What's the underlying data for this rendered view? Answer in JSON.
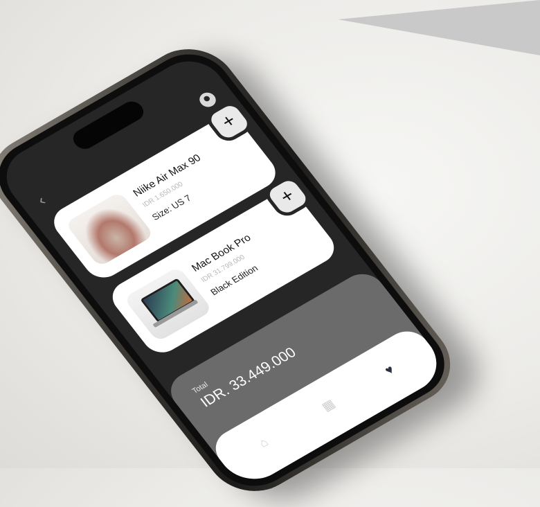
{
  "screen": {
    "items": [
      {
        "name": "Niike Air Max 90",
        "price": "IDR 1.650.000",
        "variant": "Size: US 7",
        "image_icon": "sneaker-image"
      },
      {
        "name": "Mac Book Pro",
        "price": "IDR 31.799.000",
        "variant": "Black Edition",
        "image_icon": "laptop-image"
      }
    ],
    "add_button_label": "+",
    "back_icon": "chevron-left-icon",
    "profile_icon": "user-circle-icon"
  },
  "summary": {
    "label": "Total",
    "value": "IDR. 33.449.000"
  },
  "nav": {
    "home_icon": "home-icon",
    "grid_icon": "grid-icon",
    "favorites_icon": "heart-icon",
    "active_color": "#2b3140",
    "inactive_color": "#cfcfcf"
  }
}
